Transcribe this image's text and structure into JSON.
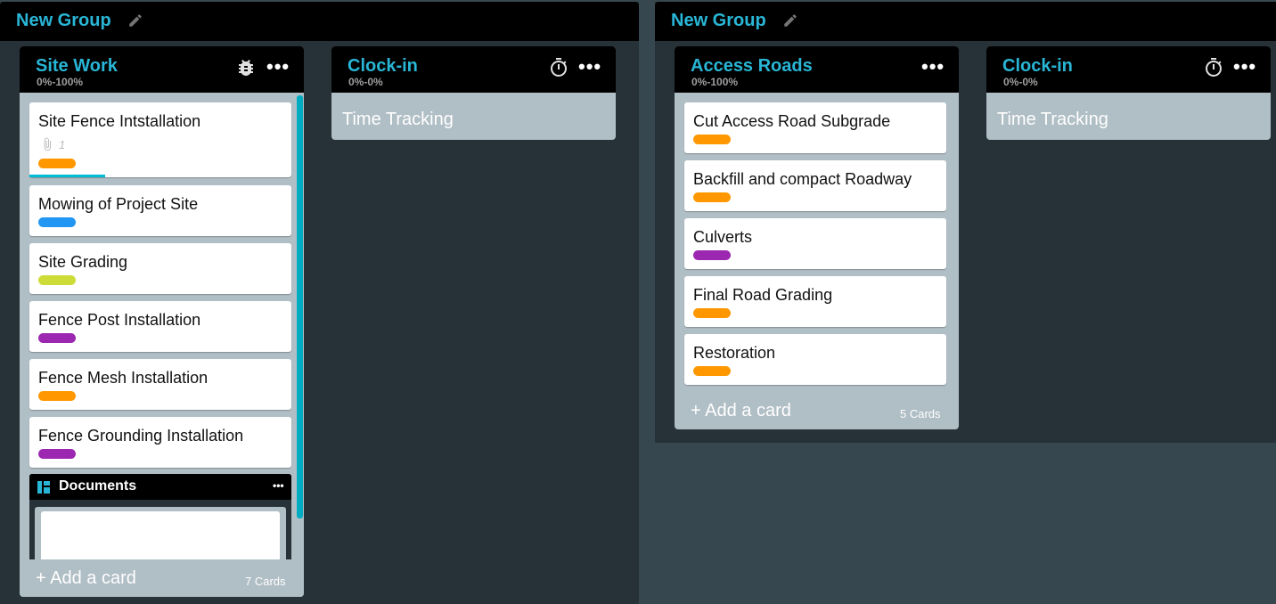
{
  "groups": [
    {
      "title": "New Group",
      "lists": [
        {
          "title": "Site Work",
          "subtitle": "0%-100%",
          "header_icon": "bug-icon",
          "cards": [
            {
              "title": "Site Fence Intstallation",
              "attachments": "1",
              "label_color": "#ff9800",
              "progress": 0.29,
              "progress_color": "#00bcd4"
            },
            {
              "title": "Mowing of Project Site",
              "label_color": "#2196f3"
            },
            {
              "title": "Site Grading",
              "label_color": "#cddc39"
            },
            {
              "title": "Fence Post Installation",
              "label_color": "#9c27b0"
            },
            {
              "title": "Fence Mesh Installation",
              "label_color": "#ff9800"
            },
            {
              "title": "Fence Grounding Installation",
              "label_color": "#9c27b0"
            }
          ],
          "documents": {
            "title": "Documents",
            "icon": "dashboard-icon"
          },
          "add_card": "+ Add a card",
          "card_count": "7 Cards"
        },
        {
          "title": "Clock-in",
          "subtitle": "0%-0%",
          "header_icon": "stopwatch-icon",
          "body": "Time Tracking"
        }
      ]
    },
    {
      "title": "New Group",
      "lists": [
        {
          "title": "Access Roads",
          "subtitle": "0%-100%",
          "cards": [
            {
              "title": "Cut Access Road Subgrade",
              "label_color": "#ff9800"
            },
            {
              "title": "Backfill and compact Roadway",
              "label_color": "#ff9800"
            },
            {
              "title": "Culverts",
              "label_color": "#9c27b0"
            },
            {
              "title": "Final Road Grading",
              "label_color": "#ff9800"
            },
            {
              "title": "Restoration",
              "label_color": "#ff9800"
            }
          ],
          "add_card": "+ Add a card",
          "card_count": "5 Cards"
        },
        {
          "title": "Clock-in",
          "subtitle": "0%-0%",
          "header_icon": "stopwatch-icon",
          "body": "Time Tracking"
        }
      ]
    }
  ],
  "colors": {
    "accent": "#29b6d6",
    "board_bg": "#37474f",
    "group_bg": "#263238",
    "list_bg": "#b0bec5",
    "header_bg": "#000000",
    "scrollbar": "#00acc1"
  }
}
